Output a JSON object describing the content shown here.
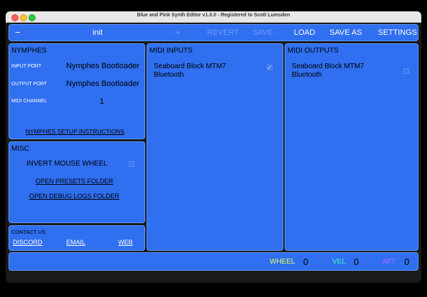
{
  "window": {
    "title": "Blue and Pink Synth Editor v1.0.0 - Registered to Scott Lumsden"
  },
  "toolbar": {
    "minus": "−",
    "preset_name": "init",
    "plus": "+",
    "revert": "REVERT",
    "save": "SAVE",
    "load": "LOAD",
    "save_as": "SAVE AS",
    "settings": "SETTINGS"
  },
  "nymphes": {
    "header": "NYMPHES",
    "input_port_label": "INPUT PORT",
    "input_port_value": "Nymphes Bootloader",
    "output_port_label": "OUTPUT PORT",
    "output_port_value": "Nymphes Bootloader",
    "midi_channel_label": "MIDI CHANNEL",
    "midi_channel_value": "1",
    "setup_link": "NYMPHES SETUP INSTRUCTIONS"
  },
  "misc": {
    "header": "MISC",
    "invert_mouse_wheel": "INVERT MOUSE WHEEL",
    "open_presets": "OPEN PRESETS FOLDER",
    "open_debug": "OPEN DEBUG LOGS FOLDER"
  },
  "contact": {
    "header": "CONTACT US",
    "discord": "DISCORD",
    "email": "EMAIL",
    "web": "WEB"
  },
  "midi_inputs": {
    "header": "MIDI INPUTS",
    "device_line1": "Seaboard Block MTM7",
    "device_line2": "Bluetooth"
  },
  "midi_outputs": {
    "header": "MIDI OUTPUTS",
    "device_line1": "Seaboard Block MTM7",
    "device_line2": "Bluetooth"
  },
  "status": {
    "wheel_label": "WHEEL",
    "wheel_value": "0",
    "wheel_color": "#e8ff5a",
    "vel_label": "VEL",
    "vel_value": "0",
    "vel_color": "#45f2c8",
    "aft_label": "AFT",
    "aft_value": "0",
    "aft_color": "#b06bff"
  }
}
